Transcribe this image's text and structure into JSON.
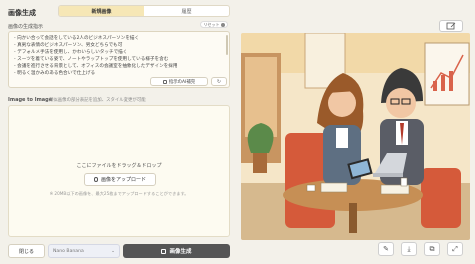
{
  "app": {
    "title": "画像生成"
  },
  "tabs": [
    {
      "label": "新規画像",
      "active": true
    },
    {
      "label": "履歴",
      "active": false
    }
  ],
  "prompt": {
    "label": "画像の生成指示",
    "reset_label": "リセット",
    "lines": [
      "- 向かい合って会話をしている2人のビジネスパーソンを描く",
      "- 真剣な表情のビジネスパーソン、男女どちらでも可",
      "- デフォルメ手法を使用し、かわいらしいタッチで描く",
      "- スーツを着ている姿で、ノートやラップトップを使用している様子を含む",
      "- 会議を進行させる背景として、オフィスの会議室を抽象化したデザインを採用",
      "- 明るく温かみのある色合いで仕上げる"
    ],
    "hint_button": "指示のAI補完",
    "refresh_icon": "refresh-icon"
  },
  "image_to_image": {
    "label": "Image to Image",
    "sublabel": "類似画像の部分表記を追加、スタイル変更が可能",
    "drop_text": "ここにファイルをドラッグ＆ドロップ",
    "upload_button": "画像をアップロード",
    "note": "※ 20MB以下の画像を、最大25枚までアップロードすることができます。"
  },
  "footer": {
    "close_button": "閉じる",
    "model_value": "Nano Banana",
    "generate_button": "画像生成"
  },
  "colors": {
    "accent_tab": "#f6e7b6",
    "generate_bg": "#555555",
    "wall": "#f5e6c8"
  },
  "image_actions": {
    "top": "edit-icon",
    "bottom": [
      "edit-icon",
      "download-icon",
      "copy-icon",
      "expand-icon"
    ]
  }
}
